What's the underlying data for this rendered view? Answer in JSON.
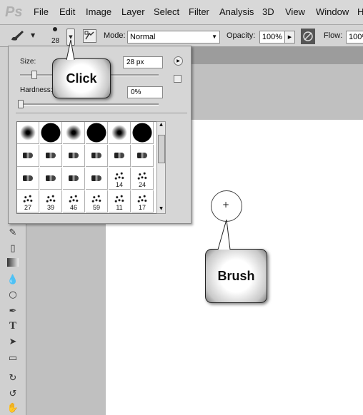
{
  "app": {
    "logo": "Ps"
  },
  "menubar": {
    "items": [
      "File",
      "Edit",
      "Image",
      "Layer",
      "Select",
      "Filter",
      "Analysis",
      "3D",
      "View",
      "Window",
      "H"
    ]
  },
  "options_bar": {
    "preset_size": "28",
    "mode_label": "Mode:",
    "mode_value": "Normal",
    "opacity_label": "Opacity:",
    "opacity_value": "100%",
    "flow_label": "Flow:",
    "flow_value": "100%"
  },
  "brush_picker": {
    "size_label": "Size:",
    "size_value": "28 px",
    "size_slider": 0.1,
    "hardness_label": "Hardness:",
    "hardness_value": "0%",
    "hardness_slider": 0.0,
    "presets": [
      {
        "kind": "soft"
      },
      {
        "kind": "hard"
      },
      {
        "kind": "soft"
      },
      {
        "kind": "hard"
      },
      {
        "kind": "soft"
      },
      {
        "kind": "hard"
      },
      {
        "kind": "bristle"
      },
      {
        "kind": "bristle"
      },
      {
        "kind": "bristle"
      },
      {
        "kind": "bristle"
      },
      {
        "kind": "bristle"
      },
      {
        "kind": "bristle"
      },
      {
        "kind": "bristle"
      },
      {
        "kind": "bristle"
      },
      {
        "kind": "bristle"
      },
      {
        "kind": "bristle"
      },
      {
        "kind": "scatter",
        "size": "14"
      },
      {
        "kind": "scatter",
        "size": "24"
      },
      {
        "kind": "scatter",
        "size": "27"
      },
      {
        "kind": "scatter",
        "size": "39"
      },
      {
        "kind": "scatter",
        "size": "46"
      },
      {
        "kind": "scatter",
        "size": "59"
      },
      {
        "kind": "scatter",
        "size": "11"
      },
      {
        "kind": "scatter",
        "size": "17"
      }
    ]
  },
  "callouts": {
    "click": "Click",
    "brush": "Brush"
  },
  "icons": [
    "brush-tool-icon",
    "brush-panel-icon",
    "pressure-icon",
    "panel-menu-icon",
    "new-preset-icon"
  ]
}
